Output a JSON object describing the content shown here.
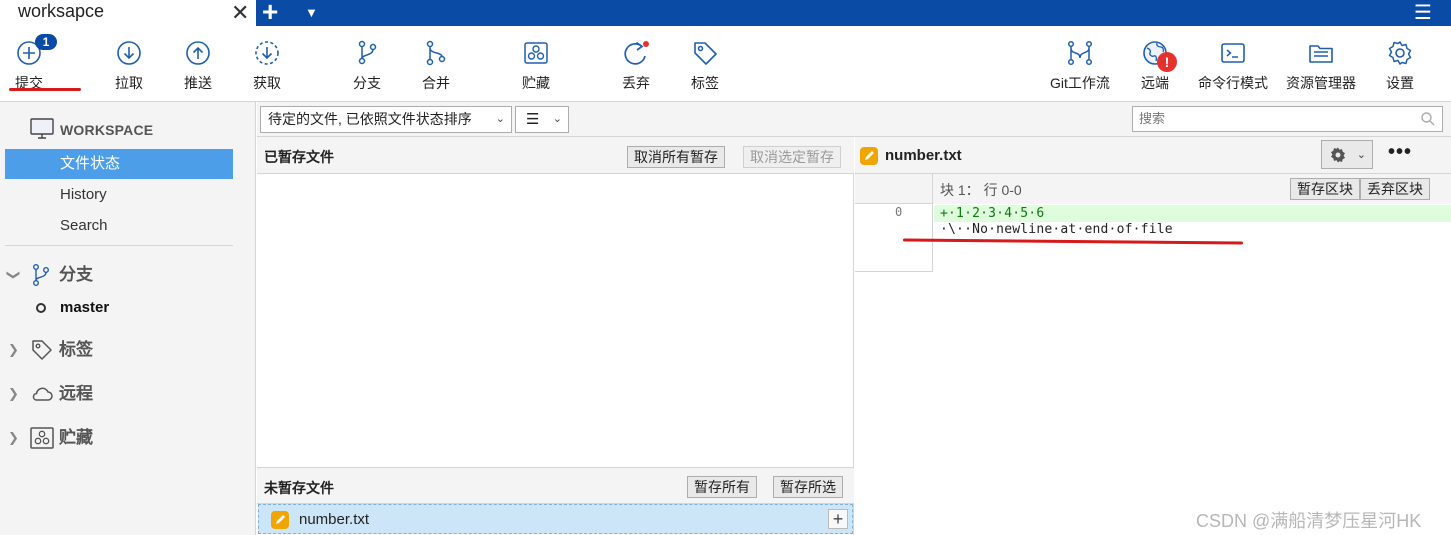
{
  "window": {
    "tab_title": "worksapce",
    "close_glyph": "✕",
    "new_tab_glyph": "+",
    "tab_dropdown_glyph": "▼",
    "menu_glyph": "☰"
  },
  "toolbar": {
    "commit": {
      "label": "提交",
      "badge": "1",
      "icon": "plus-circle-icon"
    },
    "pull": {
      "label": "拉取",
      "icon": "arrow-down-circle-icon"
    },
    "push": {
      "label": "推送",
      "icon": "arrow-up-circle-icon"
    },
    "fetch": {
      "label": "获取",
      "icon": "dashed-arrow-down-circle-icon"
    },
    "branch": {
      "label": "分支",
      "icon": "branch-icon"
    },
    "merge": {
      "label": "合并",
      "icon": "merge-icon"
    },
    "stash": {
      "label": "贮藏",
      "icon": "stash-icon"
    },
    "discard": {
      "label": "丢弃",
      "icon": "discard-icon"
    },
    "tag": {
      "label": "标签",
      "icon": "tag-icon"
    },
    "gitflow": {
      "label": "Git工作流",
      "icon": "gitflow-icon"
    },
    "remote": {
      "label": "远端",
      "alert": "!",
      "icon": "globe-icon"
    },
    "terminal": {
      "label": "命令行模式",
      "icon": "terminal-icon"
    },
    "explorer": {
      "label": "资源管理器",
      "icon": "folder-icon"
    },
    "settings": {
      "label": "设置",
      "icon": "gear-icon"
    }
  },
  "sidebar": {
    "workspace_label": "WORKSPACE",
    "items": [
      {
        "label": "文件状态",
        "active": true
      },
      {
        "label": "History",
        "active": false
      },
      {
        "label": "Search",
        "active": false
      }
    ],
    "groups": {
      "branches": {
        "label": "分支",
        "chevron": "❯",
        "expanded": true
      },
      "tags": {
        "label": "标签",
        "chevron": "❯"
      },
      "remotes": {
        "label": "远程",
        "chevron": "❯"
      },
      "stashes": {
        "label": "贮藏",
        "chevron": "❯"
      }
    },
    "branch_items": [
      {
        "name": "master",
        "current": true
      }
    ]
  },
  "filterbar": {
    "sort_value": "待定的文件, 已依照文件状态排序",
    "view_glyph": "☰",
    "caret": "⌄",
    "search_placeholder": "搜索"
  },
  "staged": {
    "title": "已暂存文件",
    "unstage_all": "取消所有暂存",
    "unstage_selected": "取消选定暂存"
  },
  "unstaged": {
    "title": "未暂存文件",
    "stage_all": "暂存所有",
    "stage_selected": "暂存所选",
    "files": [
      {
        "name": "number.txt",
        "action_glyph": "+"
      }
    ]
  },
  "diff": {
    "file_name": "number.txt",
    "more_glyph": "•••",
    "hunk_title": "块 1： 行 0-0",
    "stage_hunk": "暂存区块",
    "discard_hunk": "丢弃区块",
    "line_number": "0",
    "lines": [
      "+·1·2·3·4·5·6",
      "·\\··No·newline·at·end·of·file"
    ]
  },
  "watermark": "CSDN @满船清梦压星河HK",
  "colors": {
    "titlebar": "#0a4ba6",
    "accent_blue": "#1f5fb0",
    "selection": "#4d9ee8",
    "added_line": "#ddfddd",
    "modified_file": "#f0a500",
    "annotation_red": "#d61a1a"
  }
}
